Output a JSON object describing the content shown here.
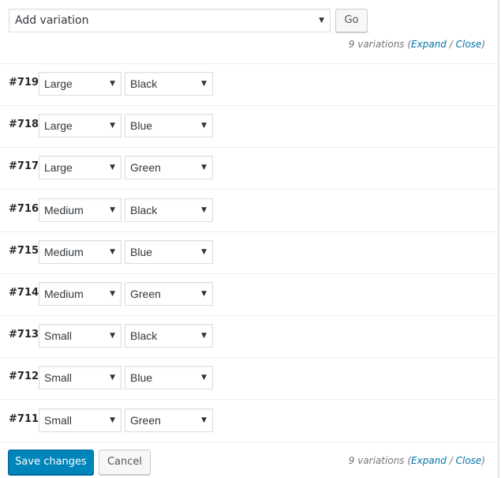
{
  "toolbar": {
    "add_select_value": "Add variation",
    "go_label": "Go",
    "count_text": "9 variations (",
    "expand_label": "Expand",
    "separator": " / ",
    "close_label": "Close",
    "count_end": ")"
  },
  "variations": [
    {
      "id": "#719",
      "size": "Large",
      "color": "Black"
    },
    {
      "id": "#718",
      "size": "Large",
      "color": "Blue"
    },
    {
      "id": "#717",
      "size": "Large",
      "color": "Green"
    },
    {
      "id": "#716",
      "size": "Medium",
      "color": "Black"
    },
    {
      "id": "#715",
      "size": "Medium",
      "color": "Blue"
    },
    {
      "id": "#714",
      "size": "Medium",
      "color": "Green"
    },
    {
      "id": "#713",
      "size": "Small",
      "color": "Black"
    },
    {
      "id": "#712",
      "size": "Small",
      "color": "Blue"
    },
    {
      "id": "#711",
      "size": "Small",
      "color": "Green"
    }
  ],
  "footer": {
    "save_label": "Save changes",
    "cancel_label": "Cancel"
  },
  "icons": {
    "caret": "▼"
  },
  "colors": {
    "primary": "#0085ba",
    "link": "#0073aa"
  }
}
